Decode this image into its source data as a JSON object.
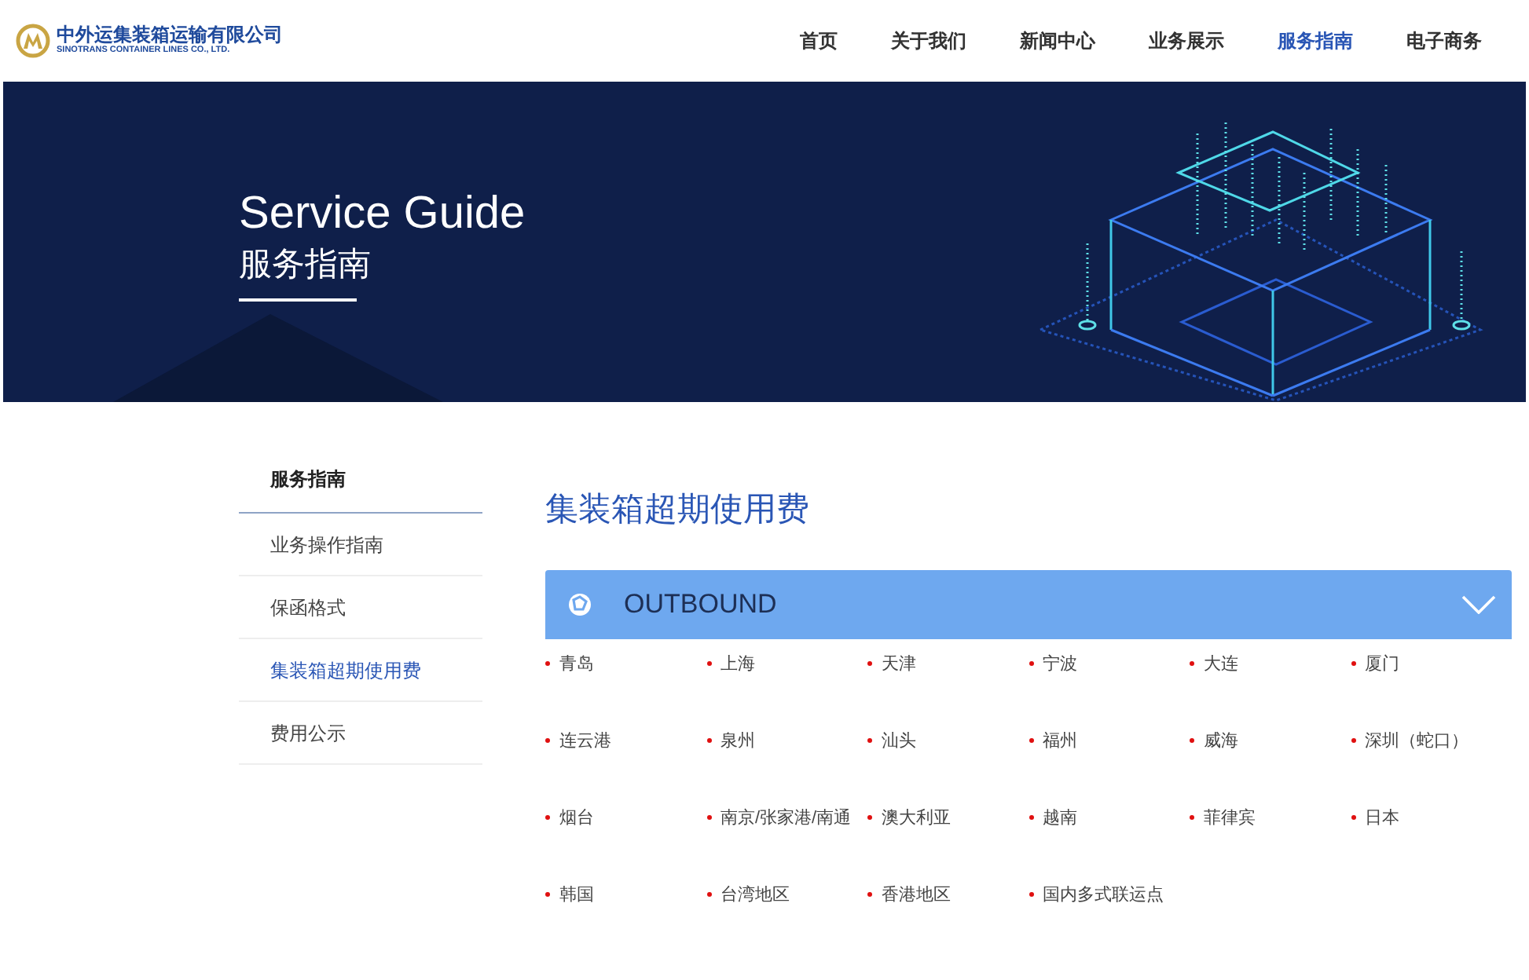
{
  "logo": {
    "name_cn": "中外运集装箱运输有限公司",
    "name_en": "SINOTRANS CONTAINER LINES CO., LTD."
  },
  "nav": [
    {
      "label": "首页",
      "selected": false
    },
    {
      "label": "关于我们",
      "selected": false
    },
    {
      "label": "新闻中心",
      "selected": false
    },
    {
      "label": "业务展示",
      "selected": false
    },
    {
      "label": "服务指南",
      "selected": true
    },
    {
      "label": "电子商务",
      "selected": false
    }
  ],
  "banner": {
    "title": "Service Guide",
    "subtitle": "服务指南"
  },
  "sidebar": {
    "title": "服务指南",
    "items": [
      {
        "label": "业务操作指南",
        "selected": false
      },
      {
        "label": "保函格式",
        "selected": false
      },
      {
        "label": "集装箱超期使用费",
        "selected": true
      },
      {
        "label": "费用公示",
        "selected": false
      }
    ]
  },
  "page_title": "集装箱超期使用费",
  "section": {
    "title": "OUTBOUND",
    "expanded": true,
    "ports": [
      "青岛",
      "上海",
      "天津",
      "宁波",
      "大连",
      "厦门",
      "连云港",
      "泉州",
      "汕头",
      "福州",
      "威海",
      "深圳（蛇口）",
      "烟台",
      "南京/张家港/南通",
      "澳大利亚",
      "越南",
      "菲律宾",
      "日本",
      "韩国",
      "台湾地区",
      "香港地区",
      "国内多式联运点"
    ]
  }
}
